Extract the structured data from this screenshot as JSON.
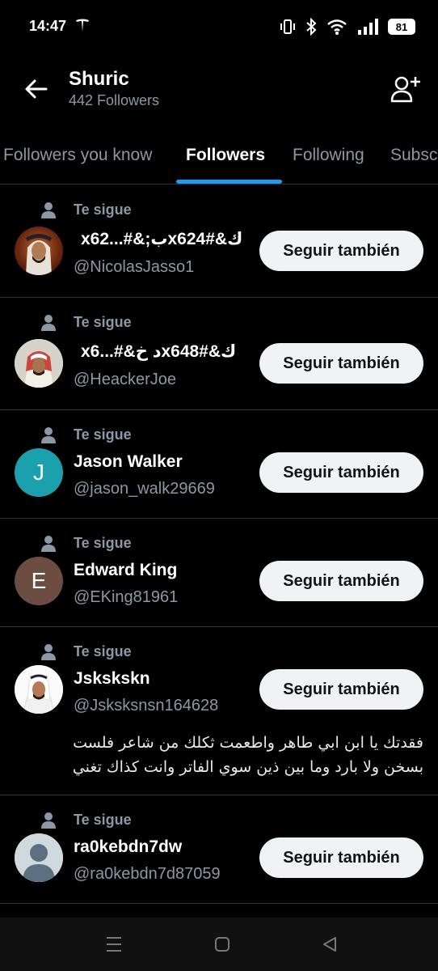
{
  "status_bar": {
    "time": "14:47",
    "battery": "81",
    "icons": [
      "tesla-icon",
      "vibrate-icon",
      "bluetooth-icon",
      "wifi-icon",
      "signal-icon",
      "battery-icon"
    ]
  },
  "header": {
    "name": "Shuric",
    "followers_count": "442 Followers",
    "icons": [
      "back-arrow-icon",
      "add-user-icon"
    ]
  },
  "tabs": [
    {
      "label": "Followers you know",
      "active": false
    },
    {
      "label": "Followers",
      "active": true
    },
    {
      "label": "Following",
      "active": false
    },
    {
      "label": "Subsc",
      "active": false
    }
  ],
  "colors": {
    "accent": "#1d9bf0",
    "background": "#000000",
    "secondary_text": "#8b98a5",
    "button_bg": "#eff3f4"
  },
  "followers": [
    {
      "follows_label": "Te sigue",
      "name": "x62...#&;بx624#&ك",
      "handle": "@NicolasJasso1",
      "button": "Seguir también",
      "avatar": "photo"
    },
    {
      "follows_label": "Te sigue",
      "name": "x6...#&د خx648#&ك",
      "handle": "@HeackerJoe",
      "button": "Seguir también",
      "avatar": "photo"
    },
    {
      "follows_label": "Te sigue",
      "name": "Jason Walker",
      "handle": "@jason_walk29669",
      "button": "Seguir también",
      "avatar": "J",
      "avatar_color": "#1ba1ad"
    },
    {
      "follows_label": "Te sigue",
      "name": "Edward King",
      "handle": "@EKing81961",
      "button": "Seguir también",
      "avatar": "E",
      "avatar_color": "#6d4c41"
    },
    {
      "follows_label": "Te sigue",
      "name": "Jskskskn",
      "handle": "@Jsksksnsn164628",
      "button": "Seguir también",
      "avatar": "photo",
      "bio_lines": [
        "فقدتك يا ابن ابي طاهر واطعمت ثكلك من شاعر فلست",
        "بسخن ولا بارد وما بين ذين سوي الفاتر وانت كذاك تغني"
      ]
    },
    {
      "follows_label": "Te sigue",
      "name": "ra0kebdn7dw",
      "handle": "@ra0kebdn7d87059",
      "button": "Seguir también",
      "avatar": "default"
    }
  ],
  "nav": {
    "icons": [
      "recents-icon",
      "home-icon",
      "back-icon"
    ]
  }
}
